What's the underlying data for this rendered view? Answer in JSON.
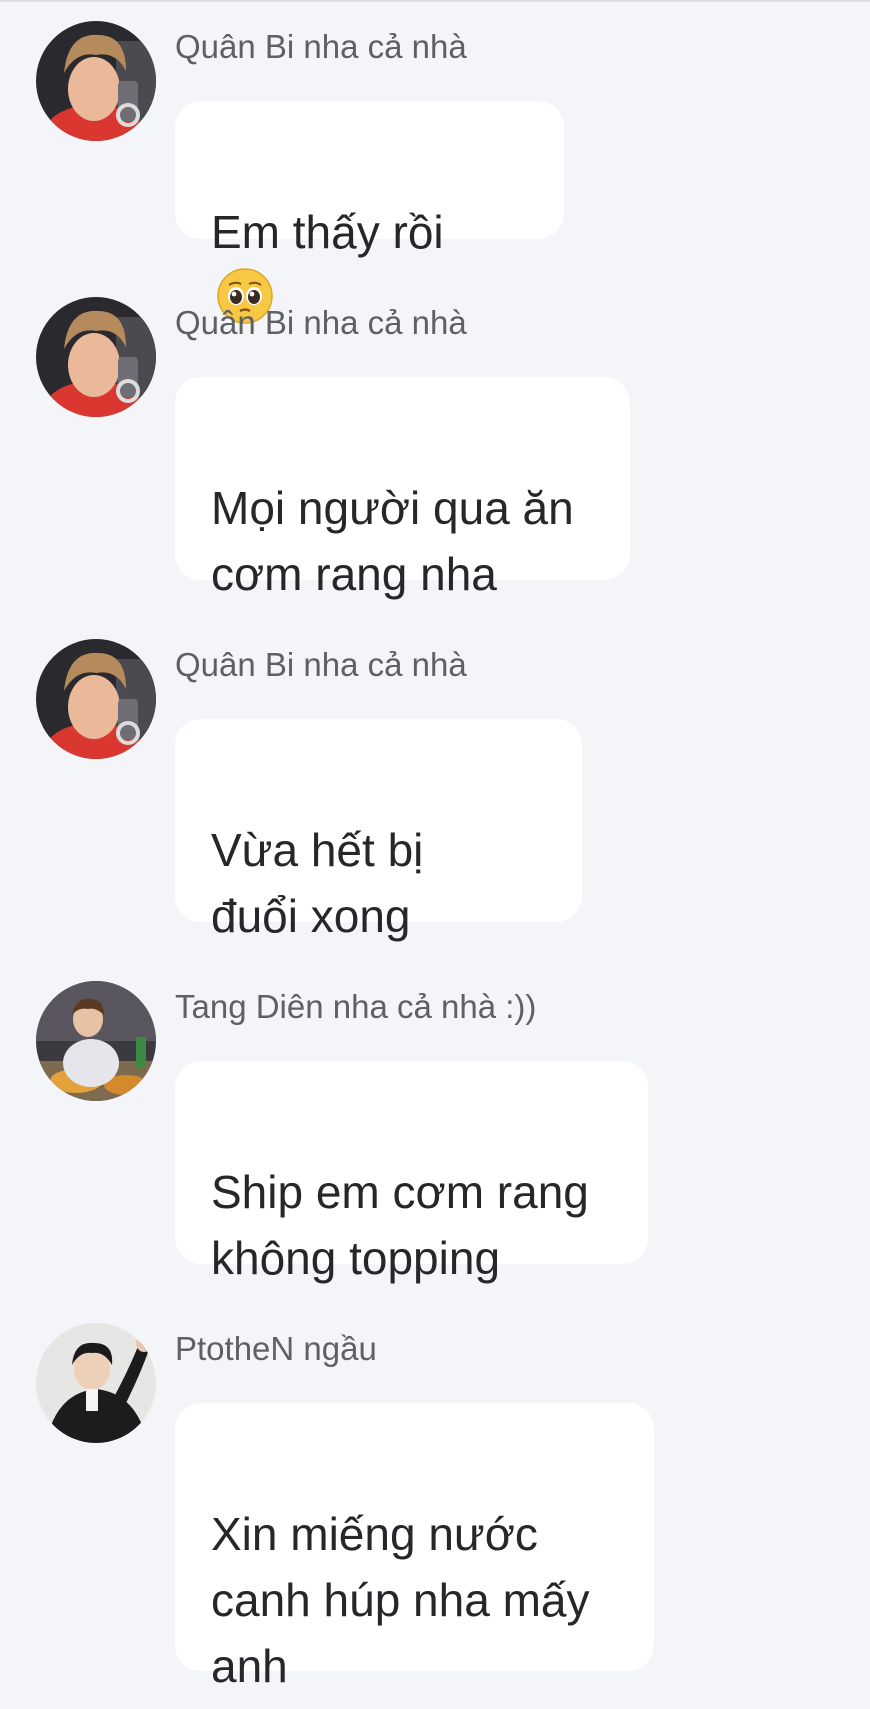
{
  "messages": [
    {
      "sender": "Quân Bi nha cả nhà",
      "text": "Em thấy rồi",
      "emoji": "pleading-face-emoji",
      "avatar": "avatar-quan-bi"
    },
    {
      "sender": "Quân Bi nha cả nhà",
      "text": "Mọi người qua ăn\ncơm rang nha",
      "avatar": "avatar-quan-bi"
    },
    {
      "sender": "Quân Bi nha cả nhà",
      "text": "Vừa hết bị\nđuổi xong",
      "avatar": "avatar-quan-bi"
    },
    {
      "sender": "Tang Diên nha cả nhà :))",
      "text": "Ship em cơm rang\nkhông topping",
      "avatar": "avatar-tang-dien"
    },
    {
      "sender": "PtotheN ngầu",
      "text": "Xin miếng nước\ncanh húp nha mấy\nanh",
      "avatar": "avatar-ptothen"
    }
  ],
  "colors": {
    "background": "#f4f5f9",
    "bubble": "#ffffff",
    "sender_text": "#5f6066",
    "message_text": "#26272b"
  }
}
